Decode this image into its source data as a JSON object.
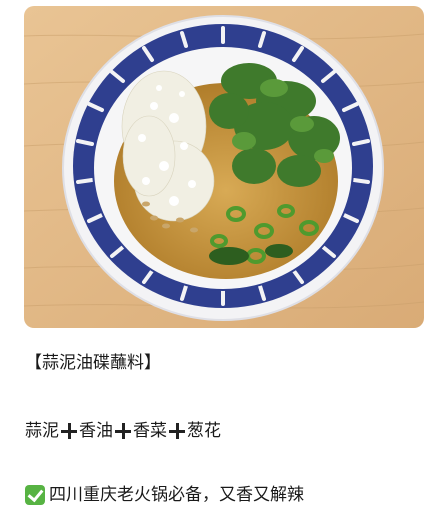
{
  "post": {
    "title": "【蒜泥油碟蘸料】",
    "formula": {
      "items": [
        "蒜泥",
        "香油",
        "香菜",
        "葱花"
      ],
      "separator_icon": "heavy-plus-icon"
    },
    "note": {
      "icon": "check-mark-button-icon",
      "text": "四川重庆老火锅必备，又香又解辣"
    }
  },
  "colors": {
    "table_wood": "#e2b886",
    "bowl_blue": "#2f3f8f",
    "oil": "#c99a3e",
    "herb_green": "#3f7a2c",
    "check_green": "#57b343"
  }
}
